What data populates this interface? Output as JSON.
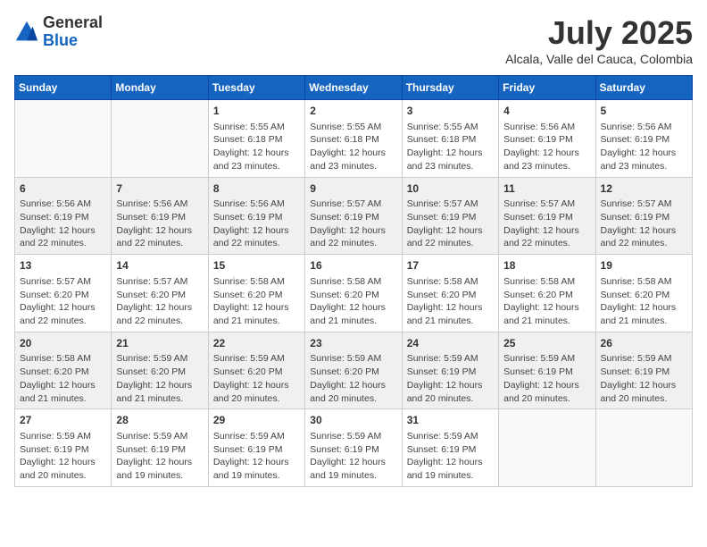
{
  "header": {
    "logo_general": "General",
    "logo_blue": "Blue",
    "month_title": "July 2025",
    "subtitle": "Alcala, Valle del Cauca, Colombia"
  },
  "weekdays": [
    "Sunday",
    "Monday",
    "Tuesday",
    "Wednesday",
    "Thursday",
    "Friday",
    "Saturday"
  ],
  "weeks": [
    {
      "shaded": false,
      "days": [
        {
          "num": "",
          "info": ""
        },
        {
          "num": "",
          "info": ""
        },
        {
          "num": "1",
          "info": "Sunrise: 5:55 AM\nSunset: 6:18 PM\nDaylight: 12 hours and 23 minutes."
        },
        {
          "num": "2",
          "info": "Sunrise: 5:55 AM\nSunset: 6:18 PM\nDaylight: 12 hours and 23 minutes."
        },
        {
          "num": "3",
          "info": "Sunrise: 5:55 AM\nSunset: 6:18 PM\nDaylight: 12 hours and 23 minutes."
        },
        {
          "num": "4",
          "info": "Sunrise: 5:56 AM\nSunset: 6:19 PM\nDaylight: 12 hours and 23 minutes."
        },
        {
          "num": "5",
          "info": "Sunrise: 5:56 AM\nSunset: 6:19 PM\nDaylight: 12 hours and 23 minutes."
        }
      ]
    },
    {
      "shaded": true,
      "days": [
        {
          "num": "6",
          "info": "Sunrise: 5:56 AM\nSunset: 6:19 PM\nDaylight: 12 hours and 22 minutes."
        },
        {
          "num": "7",
          "info": "Sunrise: 5:56 AM\nSunset: 6:19 PM\nDaylight: 12 hours and 22 minutes."
        },
        {
          "num": "8",
          "info": "Sunrise: 5:56 AM\nSunset: 6:19 PM\nDaylight: 12 hours and 22 minutes."
        },
        {
          "num": "9",
          "info": "Sunrise: 5:57 AM\nSunset: 6:19 PM\nDaylight: 12 hours and 22 minutes."
        },
        {
          "num": "10",
          "info": "Sunrise: 5:57 AM\nSunset: 6:19 PM\nDaylight: 12 hours and 22 minutes."
        },
        {
          "num": "11",
          "info": "Sunrise: 5:57 AM\nSunset: 6:19 PM\nDaylight: 12 hours and 22 minutes."
        },
        {
          "num": "12",
          "info": "Sunrise: 5:57 AM\nSunset: 6:19 PM\nDaylight: 12 hours and 22 minutes."
        }
      ]
    },
    {
      "shaded": false,
      "days": [
        {
          "num": "13",
          "info": "Sunrise: 5:57 AM\nSunset: 6:20 PM\nDaylight: 12 hours and 22 minutes."
        },
        {
          "num": "14",
          "info": "Sunrise: 5:57 AM\nSunset: 6:20 PM\nDaylight: 12 hours and 22 minutes."
        },
        {
          "num": "15",
          "info": "Sunrise: 5:58 AM\nSunset: 6:20 PM\nDaylight: 12 hours and 21 minutes."
        },
        {
          "num": "16",
          "info": "Sunrise: 5:58 AM\nSunset: 6:20 PM\nDaylight: 12 hours and 21 minutes."
        },
        {
          "num": "17",
          "info": "Sunrise: 5:58 AM\nSunset: 6:20 PM\nDaylight: 12 hours and 21 minutes."
        },
        {
          "num": "18",
          "info": "Sunrise: 5:58 AM\nSunset: 6:20 PM\nDaylight: 12 hours and 21 minutes."
        },
        {
          "num": "19",
          "info": "Sunrise: 5:58 AM\nSunset: 6:20 PM\nDaylight: 12 hours and 21 minutes."
        }
      ]
    },
    {
      "shaded": true,
      "days": [
        {
          "num": "20",
          "info": "Sunrise: 5:58 AM\nSunset: 6:20 PM\nDaylight: 12 hours and 21 minutes."
        },
        {
          "num": "21",
          "info": "Sunrise: 5:59 AM\nSunset: 6:20 PM\nDaylight: 12 hours and 21 minutes."
        },
        {
          "num": "22",
          "info": "Sunrise: 5:59 AM\nSunset: 6:20 PM\nDaylight: 12 hours and 20 minutes."
        },
        {
          "num": "23",
          "info": "Sunrise: 5:59 AM\nSunset: 6:20 PM\nDaylight: 12 hours and 20 minutes."
        },
        {
          "num": "24",
          "info": "Sunrise: 5:59 AM\nSunset: 6:19 PM\nDaylight: 12 hours and 20 minutes."
        },
        {
          "num": "25",
          "info": "Sunrise: 5:59 AM\nSunset: 6:19 PM\nDaylight: 12 hours and 20 minutes."
        },
        {
          "num": "26",
          "info": "Sunrise: 5:59 AM\nSunset: 6:19 PM\nDaylight: 12 hours and 20 minutes."
        }
      ]
    },
    {
      "shaded": false,
      "days": [
        {
          "num": "27",
          "info": "Sunrise: 5:59 AM\nSunset: 6:19 PM\nDaylight: 12 hours and 20 minutes."
        },
        {
          "num": "28",
          "info": "Sunrise: 5:59 AM\nSunset: 6:19 PM\nDaylight: 12 hours and 19 minutes."
        },
        {
          "num": "29",
          "info": "Sunrise: 5:59 AM\nSunset: 6:19 PM\nDaylight: 12 hours and 19 minutes."
        },
        {
          "num": "30",
          "info": "Sunrise: 5:59 AM\nSunset: 6:19 PM\nDaylight: 12 hours and 19 minutes."
        },
        {
          "num": "31",
          "info": "Sunrise: 5:59 AM\nSunset: 6:19 PM\nDaylight: 12 hours and 19 minutes."
        },
        {
          "num": "",
          "info": ""
        },
        {
          "num": "",
          "info": ""
        }
      ]
    }
  ]
}
